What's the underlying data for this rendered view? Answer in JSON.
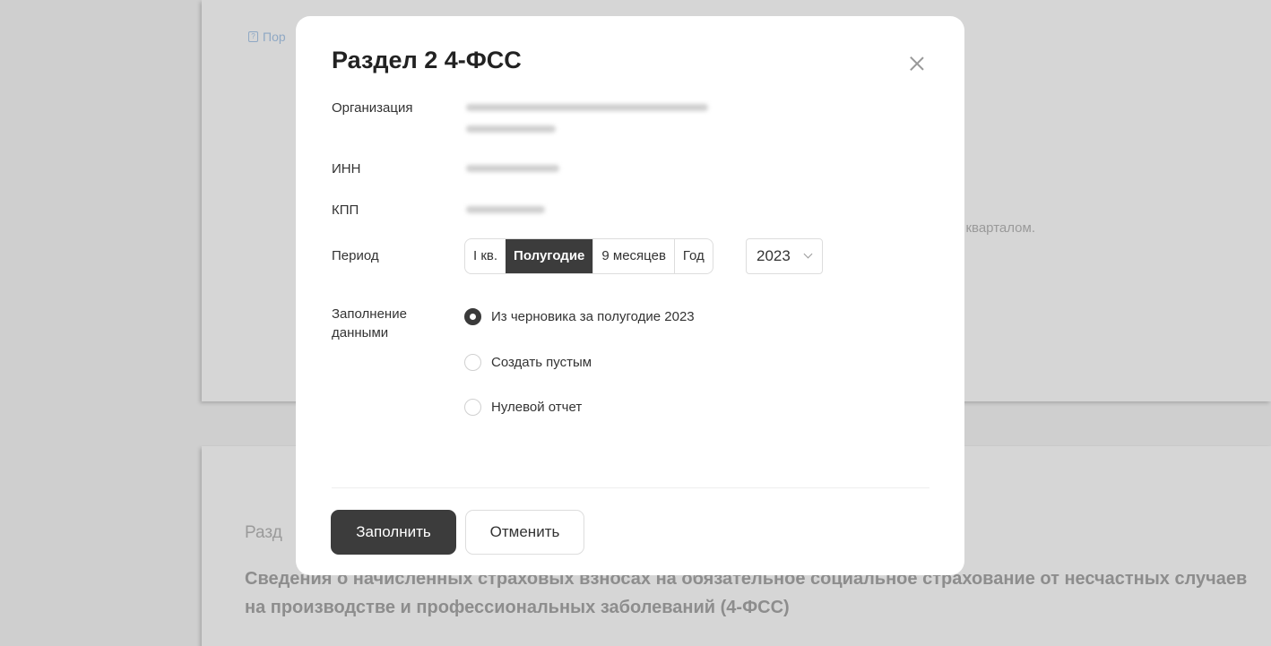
{
  "background": {
    "help_link_fragment": "Пор",
    "hint_fragment": "м кварталом.",
    "section_fragment": "Разд",
    "section_description": "Сведения о начисленных страховых взносах на обязательное социальное страхование от несчастных случаев на производстве и профессиональных заболеваний (4-ФСС)"
  },
  "modal": {
    "title": "Раздел 2 4-ФСС",
    "close_icon": "close-icon",
    "fields": {
      "organization_label": "Организация",
      "inn_label": "ИНН",
      "kpp_label": "КПП",
      "period_label": "Период",
      "fill_label_line1": "Заполнение",
      "fill_label_line2": "данными"
    },
    "period_options": [
      "I кв.",
      "Полугодие",
      "9 месяцев",
      "Год"
    ],
    "period_selected": "Полугодие",
    "year_selected": "2023",
    "fill_options": [
      {
        "label": "Из черновика за полугодие 2023",
        "checked": true
      },
      {
        "label": "Создать пустым",
        "checked": false
      },
      {
        "label": "Нулевой отчет",
        "checked": false
      }
    ],
    "buttons": {
      "fill": "Заполнить",
      "cancel": "Отменить"
    }
  },
  "colors": {
    "primary_button": "#3c3c3c",
    "help_link": "#8fa8c4"
  }
}
